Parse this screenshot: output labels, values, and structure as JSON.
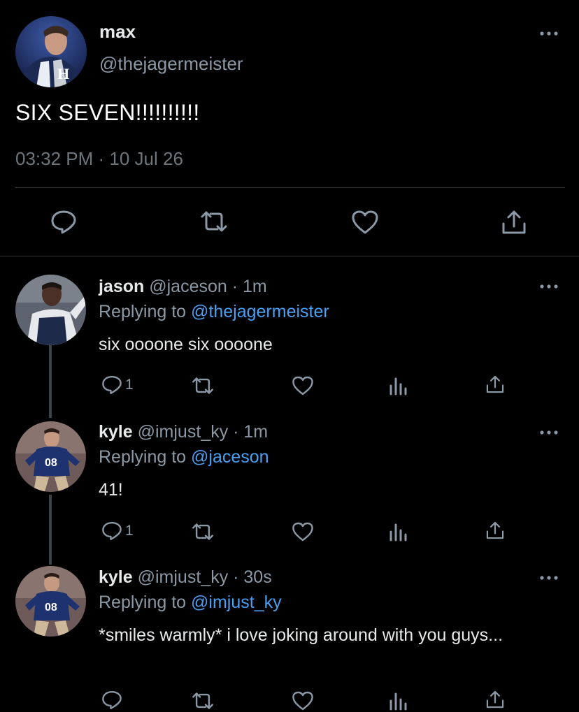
{
  "main_tweet": {
    "name": "max",
    "handle": "@thejagermeister",
    "text": "SIX SEVEN!!!!!!!!!!",
    "timestamp": "03:32 PM · 10 Jul 26",
    "avatar_letter": "H"
  },
  "replies": [
    {
      "name": "jason",
      "meta": "@jaceson · 1m",
      "replying_prefix": "Replying to ",
      "replying_to": "@thejagermeister",
      "text": "six oooone six oooone",
      "reply_count": "1"
    },
    {
      "name": "kyle",
      "meta": "@imjust_ky · 1m",
      "replying_prefix": "Replying to ",
      "replying_to": "@jaceson",
      "text": "41!",
      "reply_count": "1"
    },
    {
      "name": "kyle",
      "meta": "@imjust_ky · 30s",
      "replying_prefix": "Replying to ",
      "replying_to": "@imjust_ky",
      "text": "*smiles warmly* i love joking around with you guys...",
      "reply_count": ""
    }
  ],
  "icons": {
    "reply": "reply-icon",
    "retweet": "retweet-icon",
    "like": "heart-icon",
    "share": "share-icon",
    "views": "views-icon",
    "more": "more-icon"
  },
  "colors": {
    "background": "#000000",
    "text": "#e7e9ea",
    "secondary": "#8b98a5",
    "link": "#4a9ff0",
    "divider": "#2f3336"
  }
}
